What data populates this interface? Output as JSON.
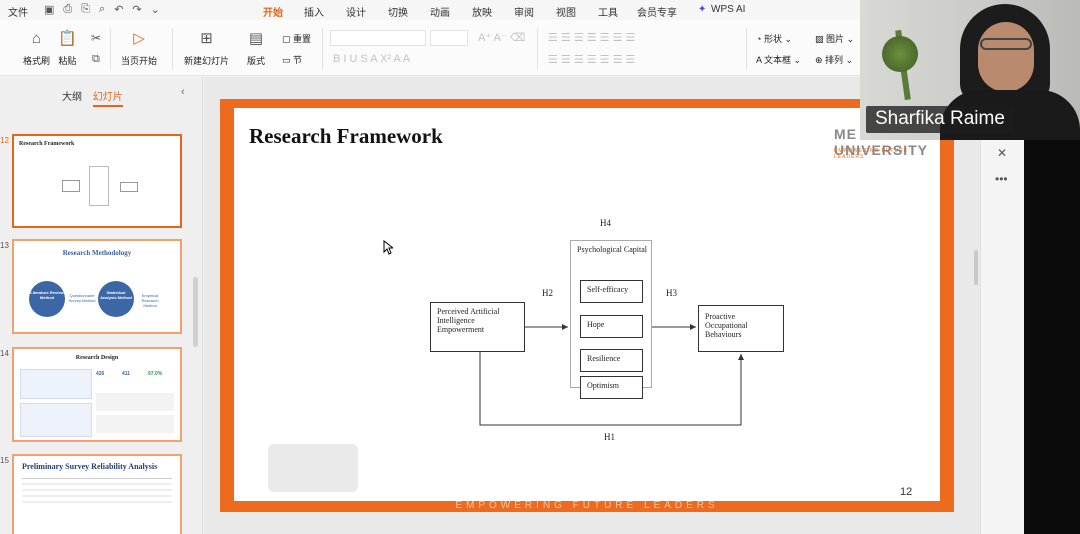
{
  "topbar": {
    "file_menu": "文件",
    "tabs": [
      "开始",
      "插入",
      "设计",
      "切换",
      "动画",
      "放映",
      "审阅",
      "视图",
      "工具",
      "会员专享",
      "WPS AI"
    ],
    "active_tab": "开始"
  },
  "ribbon": {
    "format_painter": "格式刷",
    "paste": "粘贴",
    "from_current": "当页开始",
    "new_slide": "新建幻灯片",
    "layout": "版式",
    "reset": "重置",
    "section": "节",
    "shape": "形状",
    "picture": "图片",
    "textbox": "文本框",
    "arrange": "排列"
  },
  "sidebar": {
    "tab_outline": "大纲",
    "tab_slides": "幻灯片",
    "slides": [
      {
        "num": "12",
        "title": "Research Framework"
      },
      {
        "num": "13",
        "title": "Research Methodology",
        "items": [
          "Literature Review Method",
          "Questionnaire Survey Method",
          "Statistical Analysis Method",
          "Empirical Research Method"
        ]
      },
      {
        "num": "14",
        "title": "Research Design",
        "stats": [
          "426",
          "411",
          "97.0%"
        ]
      },
      {
        "num": "15",
        "title": "Preliminary Survey Reliability Analysis"
      }
    ]
  },
  "slide": {
    "title": "Research Framework",
    "logo": "ME UNIVERSITY",
    "logo_tagline": "EMPOWERING FUTURE LEADERS",
    "page_number": "12",
    "footer": "EMPOWERING FUTURE LEADERS",
    "diagram": {
      "input_box": "Perceived Artificial Intelligence Empowerment",
      "mediator_title": "Psychological Capital",
      "mediators": [
        "Self-efficacy",
        "Hope",
        "Resilience",
        "Optimism"
      ],
      "output_box": "Proactive Occupational Behaviours",
      "h1": "H1",
      "h2": "H2",
      "h3": "H3",
      "h4": "H4"
    }
  },
  "video": {
    "participant_name": "Sharfika Raime"
  }
}
